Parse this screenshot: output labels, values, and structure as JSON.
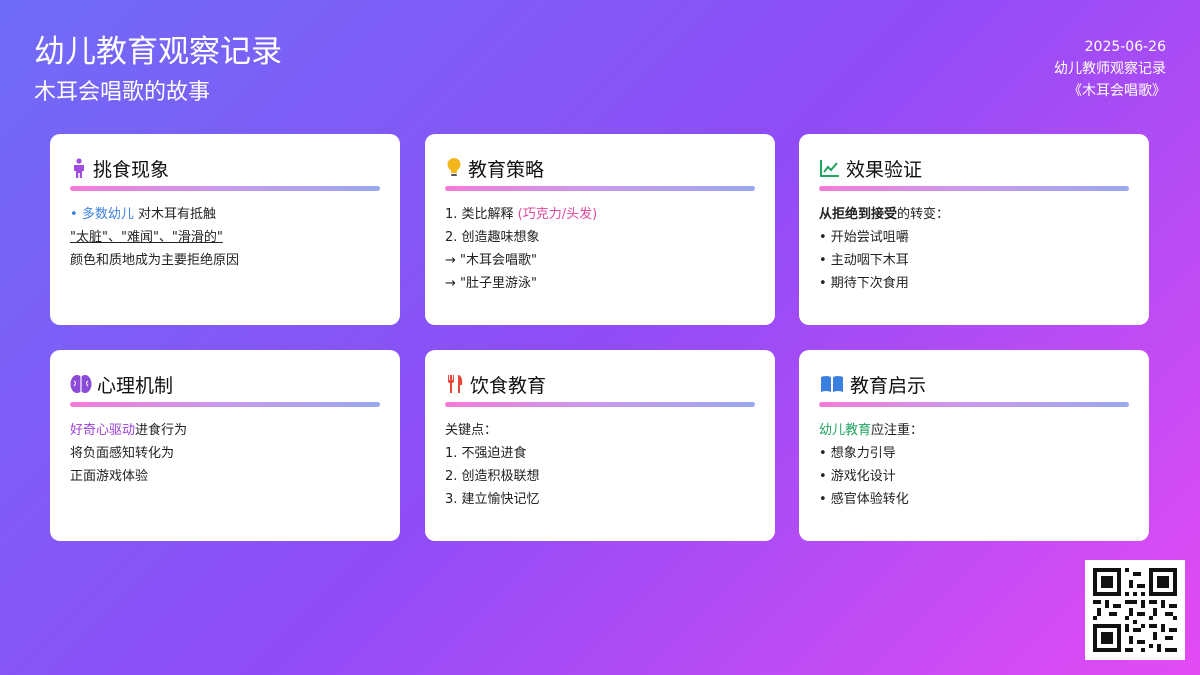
{
  "header": {
    "title": "幼儿教育观察记录",
    "subtitle": "木耳会唱歌的故事",
    "date": "2025-06-26",
    "author": "幼儿教师观察记录",
    "book": "《木耳会唱歌》"
  },
  "cards": [
    {
      "icon": "person-icon",
      "title": "挑食现象",
      "l1_bullet": "•",
      "l1_highlight": "多数幼儿",
      "l1_rest": " 对木耳有抵触",
      "l2": "\"太脏\"、\"难闻\"、\"滑滑的\"",
      "l3": "颜色和质地成为主要拒绝原因"
    },
    {
      "icon": "lightbulb-icon",
      "title": "教育策略",
      "l1_text": "1. 类比解释 ",
      "l1_highlight": "(巧克力/头发)",
      "l2": "2. 创造趣味想象",
      "l3": "→ \"木耳会唱歌\"",
      "l4": "→ \"肚子里游泳\""
    },
    {
      "icon": "chart-line-icon",
      "title": "效果验证",
      "l1_bold": "从拒绝到接受",
      "l1_rest": "的转变：",
      "l2": "• 开始尝试咀嚼",
      "l3": "• 主动咽下木耳",
      "l4": "• 期待下次食用"
    },
    {
      "icon": "brain-icon",
      "title": "心理机制",
      "l1_highlight": "好奇心驱动",
      "l1_rest": "进食行为",
      "l2": "将负面感知转化为",
      "l3": "正面游戏体验"
    },
    {
      "icon": "utensils-icon",
      "title": "饮食教育",
      "l1": "关键点：",
      "l2": "1. 不强迫进食",
      "l3": "2. 创造积极联想",
      "l4": "3. 建立愉快记忆"
    },
    {
      "icon": "book-icon",
      "title": "教育启示",
      "l1_highlight": "幼儿教育",
      "l1_rest": "应注重：",
      "l2": "• 想象力引导",
      "l3": "• 游戏化设计",
      "l4": "• 感官体验转化"
    }
  ],
  "colors": {
    "bg_start": "#6f6cf7",
    "bg_end": "#e34bf3",
    "blue": "#3b7fe0",
    "pink": "#e0489e",
    "purple": "#9a3fd6",
    "green": "#1fa462"
  },
  "qr_code": "qr-code"
}
